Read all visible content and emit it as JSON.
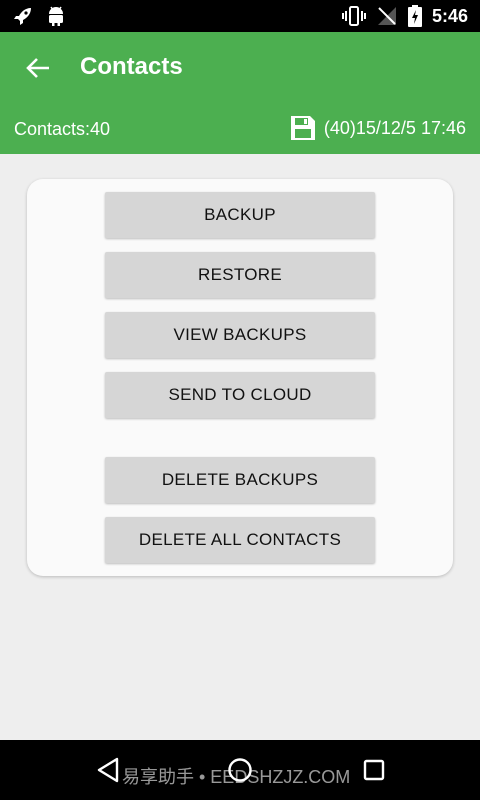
{
  "status_bar": {
    "time": "5:46",
    "left_icons": [
      "rocket-icon",
      "android-icon"
    ],
    "right_icons": [
      "vibrate-icon",
      "no-signal-icon",
      "battery-charging-icon"
    ]
  },
  "app_bar": {
    "title": "Contacts",
    "contacts_count": "Contacts:40",
    "last_backup": "(40)15/12/5 17:46",
    "color": "#4caf50"
  },
  "actions": {
    "backup": "BACKUP",
    "restore": "RESTORE",
    "view_backups": "VIEW BACKUPS",
    "send_to_cloud": "SEND TO CLOUD",
    "delete_backups": "DELETE BACKUPS",
    "delete_all_contacts": "DELETE ALL CONTACTS"
  },
  "nav_bar": {
    "icons": [
      "back-triangle-icon",
      "home-circle-icon",
      "recents-square-icon"
    ]
  },
  "watermark": "易享助手 • EEDSHZJZ.COM"
}
